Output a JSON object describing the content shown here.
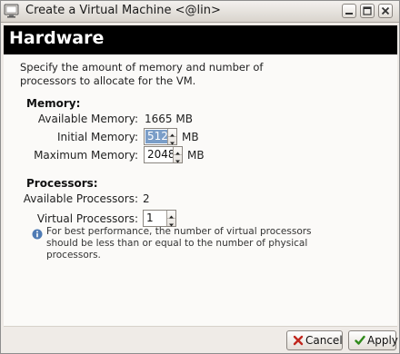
{
  "window": {
    "title": "Create a Virtual Machine <@lin>"
  },
  "banner": {
    "title": "Hardware"
  },
  "intro": "Specify the amount of memory and number of processors to allocate for the VM.",
  "memory": {
    "heading": "Memory:",
    "available_label": "Available Memory:",
    "available_value": "1665 MB",
    "initial_label": "Initial Memory:",
    "initial_value": "512",
    "initial_unit": "MB",
    "maximum_label": "Maximum Memory:",
    "maximum_value": "2048",
    "maximum_unit": "MB"
  },
  "processors": {
    "heading": "Processors:",
    "available_label": "Available Processors:",
    "available_value": "2",
    "virtual_label": "Virtual Processors:",
    "virtual_value": "1",
    "hint": "For best performance, the number of virtual processors should be less than or equal to the number of physical processors."
  },
  "buttons": {
    "cancel": "Cancel",
    "apply": "Apply"
  },
  "icons": {
    "title": "vm-app-icon",
    "minimize": "minimize-icon",
    "maximize": "maximize-icon",
    "close": "close-icon",
    "info": "info-icon",
    "cancel": "cancel-x-icon",
    "apply": "checkmark-icon"
  },
  "colors": {
    "banner_bg": "#000000",
    "banner_text": "#ffffff",
    "selection": "#7b9ec8",
    "info_icon": "#4f7bb4",
    "cancel_icon": "#c0261d",
    "apply_icon": "#2f8a1a"
  }
}
